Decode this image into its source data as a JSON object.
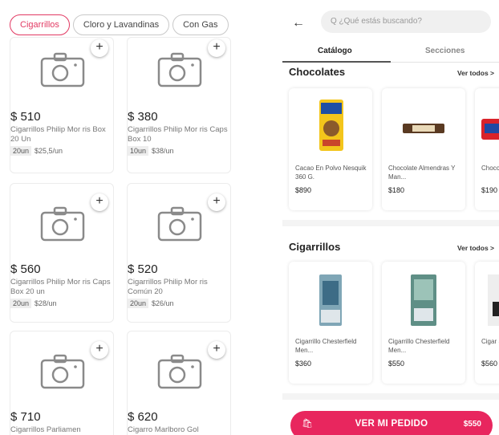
{
  "left": {
    "chips": [
      "Cigarrillos",
      "Cloro y Lavandinas",
      "Con Gas"
    ],
    "products": [
      {
        "price": "$ 510",
        "name": "Cigarrillos Philip Mor ris Box 20 Un",
        "qty": "20un",
        "unit_price": "$25,5/un"
      },
      {
        "price": "$ 380",
        "name": "Cigarrillos Philip Mor ris Caps Box 10",
        "qty": "10un",
        "unit_price": "$38/un"
      },
      {
        "price": "$ 560",
        "name": "Cigarrillos Philip Mor ris Caps Box 20 un",
        "qty": "20un",
        "unit_price": "$28/un"
      },
      {
        "price": "$ 520",
        "name": "Cigarrillos Philip Mor ris Común 20",
        "qty": "20un",
        "unit_price": "$26/un"
      },
      {
        "price": "$ 710",
        "name": "Cigarrillos Parliamen",
        "qty": "",
        "unit_price": ""
      },
      {
        "price": "$ 620",
        "name": "Cigarro Marlboro Gol",
        "qty": "",
        "unit_price": ""
      }
    ],
    "add_symbol": "+"
  },
  "right": {
    "back_symbol": "←",
    "search_placeholder": "Q ¿Qué estás buscando?",
    "tabs": [
      "Catálogo",
      "Secciones"
    ],
    "sections": [
      {
        "title": "Chocolates",
        "see_all": "Ver todos >",
        "items": [
          {
            "name": "Cacao En Polvo Nesquik 360 G.",
            "price": "$890"
          },
          {
            "name": "Chocolate Almendras Y Man...",
            "price": "$180"
          },
          {
            "name": "Choco G.",
            "price": "$190"
          }
        ]
      },
      {
        "title": "Cigarrillos",
        "see_all": "Ver todos >",
        "items": [
          {
            "name": "Cigarrillo Chesterfield Men...",
            "price": "$360"
          },
          {
            "name": "Cigarrillo Chesterfield Men...",
            "price": "$550"
          },
          {
            "name": "Cigar Strike",
            "price": "$560"
          }
        ]
      }
    ],
    "order_button": {
      "label": "VER MI PEDIDO",
      "total": "$550",
      "icon": "bag-icon"
    }
  },
  "colors": {
    "accent": "#e8265e",
    "chip_active": "#e23a63"
  }
}
